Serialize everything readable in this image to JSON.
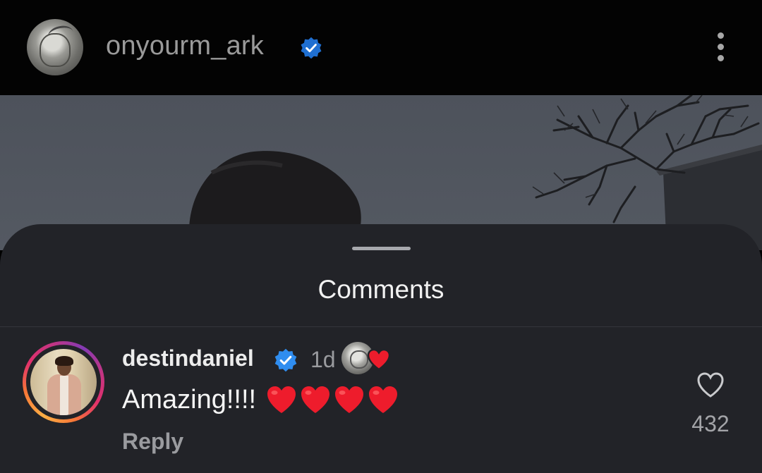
{
  "post": {
    "username": "onyourm_ark",
    "verified": true,
    "avatar_icon": "sketch-avatar"
  },
  "comments_sheet": {
    "title": "Comments",
    "comments": [
      {
        "username": "destindaniel",
        "verified": true,
        "time": "1d",
        "text": "Amazing!!!!",
        "emoji": "❤️❤️❤️❤️",
        "reply_label": "Reply",
        "like_count": "432",
        "liked_by_creator": true
      }
    ]
  },
  "colors": {
    "verified_blue": "#2f8df0",
    "heart_red": "#ee1c2c",
    "sheet_bg": "#222328"
  }
}
